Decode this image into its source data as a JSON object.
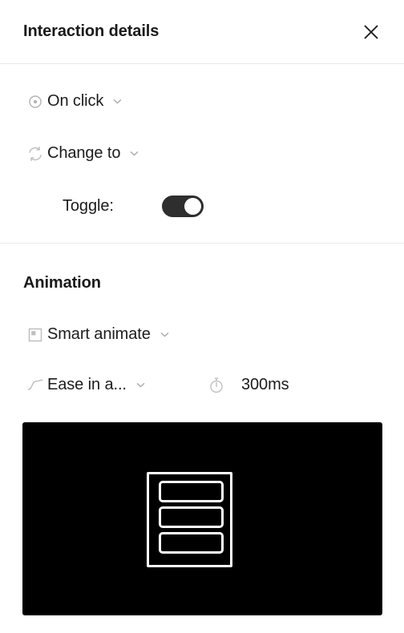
{
  "header": {
    "title": "Interaction details",
    "close_icon": "close-icon"
  },
  "trigger": {
    "icon": "click-target-icon",
    "label": "On click",
    "dropdown_icon": "chevron-down-icon"
  },
  "action": {
    "icon": "swap-cycle-icon",
    "label": "Change to",
    "dropdown_icon": "chevron-down-icon"
  },
  "toggle_field": {
    "label": "Toggle:",
    "state": "on"
  },
  "animation": {
    "heading": "Animation",
    "type": {
      "icon": "smart-animate-icon",
      "label": "Smart animate",
      "dropdown_icon": "chevron-down-icon"
    },
    "easing": {
      "icon": "ease-curve-icon",
      "label": "Ease in a...",
      "dropdown_icon": "chevron-down-icon"
    },
    "duration": {
      "icon": "stopwatch-icon",
      "value": "300ms"
    }
  },
  "preview": {
    "background_color": "#000000",
    "stroke_color": "#ffffff",
    "bar_count": 3
  },
  "colors": {
    "text": "#1c1c1c",
    "icon": "#b3b3b3",
    "divider": "#e8e8e8",
    "toggle_on": "#2e2e2e"
  }
}
